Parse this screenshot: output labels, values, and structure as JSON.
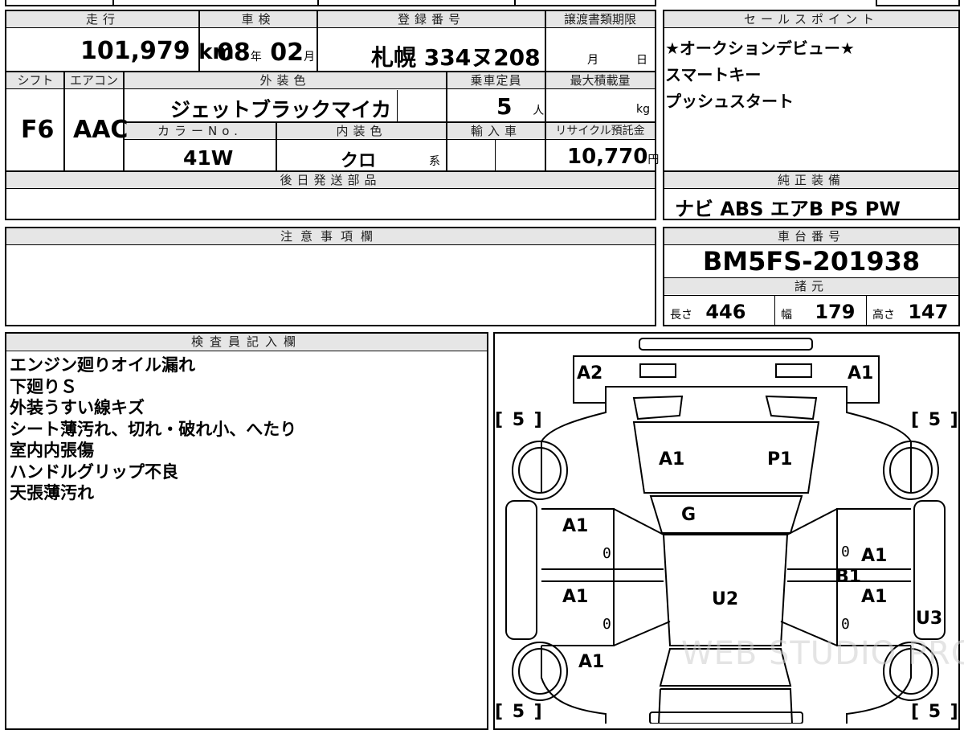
{
  "vehicle": {
    "labels": {
      "mileage": "走行",
      "inspection": "車検",
      "registration": "登録番号",
      "doc_deadline": "譲渡書類期限",
      "shift": "シフト",
      "aircon": "エアコン",
      "exterior_color": "外装色",
      "capacity": "乗車定員",
      "max_load": "最大積載量",
      "color_no": "カラーNo.",
      "interior_color": "内装色",
      "import": "輸入車",
      "recycle": "リサイクル預託金",
      "later_parts": "後日発送部品",
      "notes": "注意事項欄",
      "sales_points": "セールスポイント",
      "equipment": "純正装備",
      "chassis": "車台番号",
      "specs": "諸元",
      "inspector": "検査員記入欄"
    },
    "mileage": "101,979",
    "mileage_unit": "km",
    "inspection_year": "08",
    "year_unit": "年",
    "inspection_month": "02",
    "month_unit": "月",
    "registration": "札幌 334ヌ208",
    "doc_month": "月",
    "doc_day": "日",
    "shift": "F6",
    "aircon": "AAC",
    "exterior_color": "ジェットブラックマイカ",
    "capacity": "5",
    "capacity_unit": "人",
    "max_load_unit": "kg",
    "color_no": "41W",
    "interior_color": "クロ",
    "interior_suffix": "系",
    "recycle": "10,770",
    "recycle_unit": "円",
    "equipment": "ナビ ABS エアB PS PW",
    "chassis_no": "BM5FS-201938",
    "length_label": "長さ",
    "length": "446",
    "width_label": "幅",
    "width": "179",
    "height_label": "高さ",
    "height": "147"
  },
  "sales_points": [
    "★オークションデビュー★",
    "スマートキー",
    "プッシュスタート"
  ],
  "inspector_notes": [
    "エンジン廻りオイル漏れ",
    "下廻りＳ",
    "外装うすい線キズ",
    "シート薄汚れ、切れ・破れ小、へたり",
    "室内内張傷",
    "ハンドルグリップ不良",
    "天張薄汚れ"
  ],
  "diagram": {
    "tire_labels": [
      "[ 5 ]",
      "[ 5 ]",
      "[ 5 ]",
      "[ 5 ]"
    ],
    "codes": {
      "front_left": "A2",
      "front_right": "A1",
      "hood_left": "A1",
      "hood_right": "P1",
      "windshield": "G",
      "left_front_door": "A1",
      "left_rear_door": "A1",
      "right_front_door": "A1",
      "right_rear_door": "A1",
      "right_pillar": "B1",
      "roof": "U2",
      "right_sill": "U3",
      "left_rear_fender": "A1"
    },
    "zero_mark": "0",
    "watermark": "WEB STUDIO PRO"
  }
}
